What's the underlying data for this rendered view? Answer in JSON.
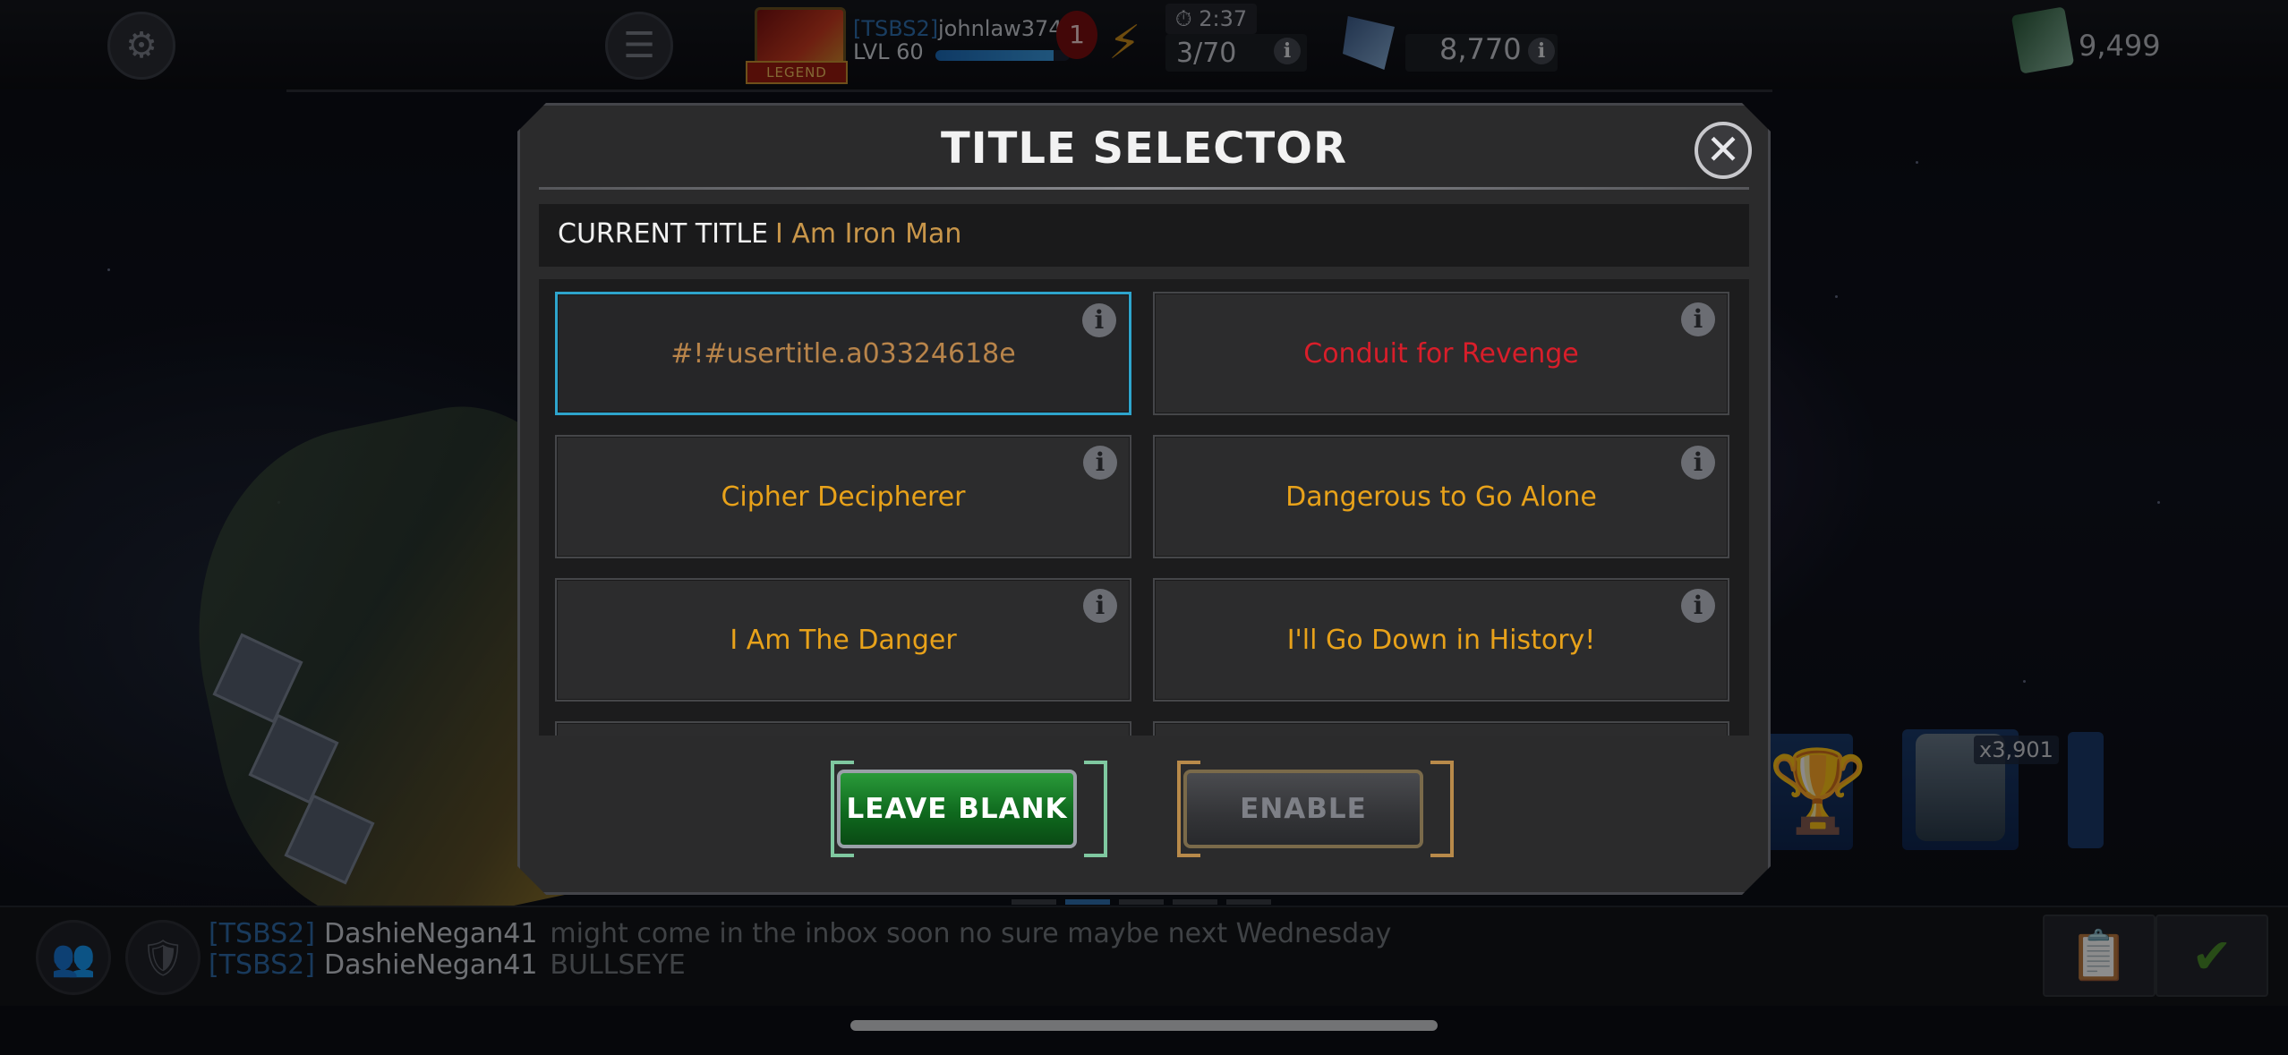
{
  "topbar": {
    "alliance_tag": "[TSBS2]",
    "player_name": "johnlaw374",
    "player_level": "LVL 60",
    "legend_label": "LEGEND",
    "notification_count": "1",
    "timer": "2:37",
    "energy": "3/70",
    "units": "8,770",
    "gold": "9,499",
    "xp_progress_percent": 88
  },
  "side": {
    "crystal_count": "x3,901"
  },
  "modal": {
    "title": "TITLE SELECTOR",
    "current_title_label": "CURRENT TITLE",
    "current_title_value": "I Am Iron Man",
    "titles": [
      {
        "text": "#!#usertitle.a03324618e",
        "color": "#b8844a",
        "selected": true
      },
      {
        "text": "Conduit for Revenge",
        "color": "#d81e2a",
        "selected": false
      },
      {
        "text": "Cipher Decipherer",
        "color": "#e8a21a",
        "selected": false
      },
      {
        "text": "Dangerous to Go Alone",
        "color": "#e8a21a",
        "selected": false
      },
      {
        "text": "I Am The Danger",
        "color": "#e8a21a",
        "selected": false
      },
      {
        "text": "I'll Go Down in History!",
        "color": "#e8a21a",
        "selected": false
      }
    ],
    "leave_blank_label": "LEAVE BLANK",
    "enable_label": "ENABLE"
  },
  "chat": {
    "lines": [
      {
        "tag": "[TSBS2]",
        "user": "DashieNegan41",
        "message": "might come in the inbox soon no sure maybe next Wednesday"
      },
      {
        "tag": "[TSBS2]",
        "user": "DashieNegan41",
        "message": "BULLSEYE"
      }
    ]
  },
  "colors": {
    "accent_selected": "#2ea4cc",
    "button_green": "#0f6a1e",
    "title_gold": "#e8a21a",
    "title_red": "#d81e2a"
  }
}
